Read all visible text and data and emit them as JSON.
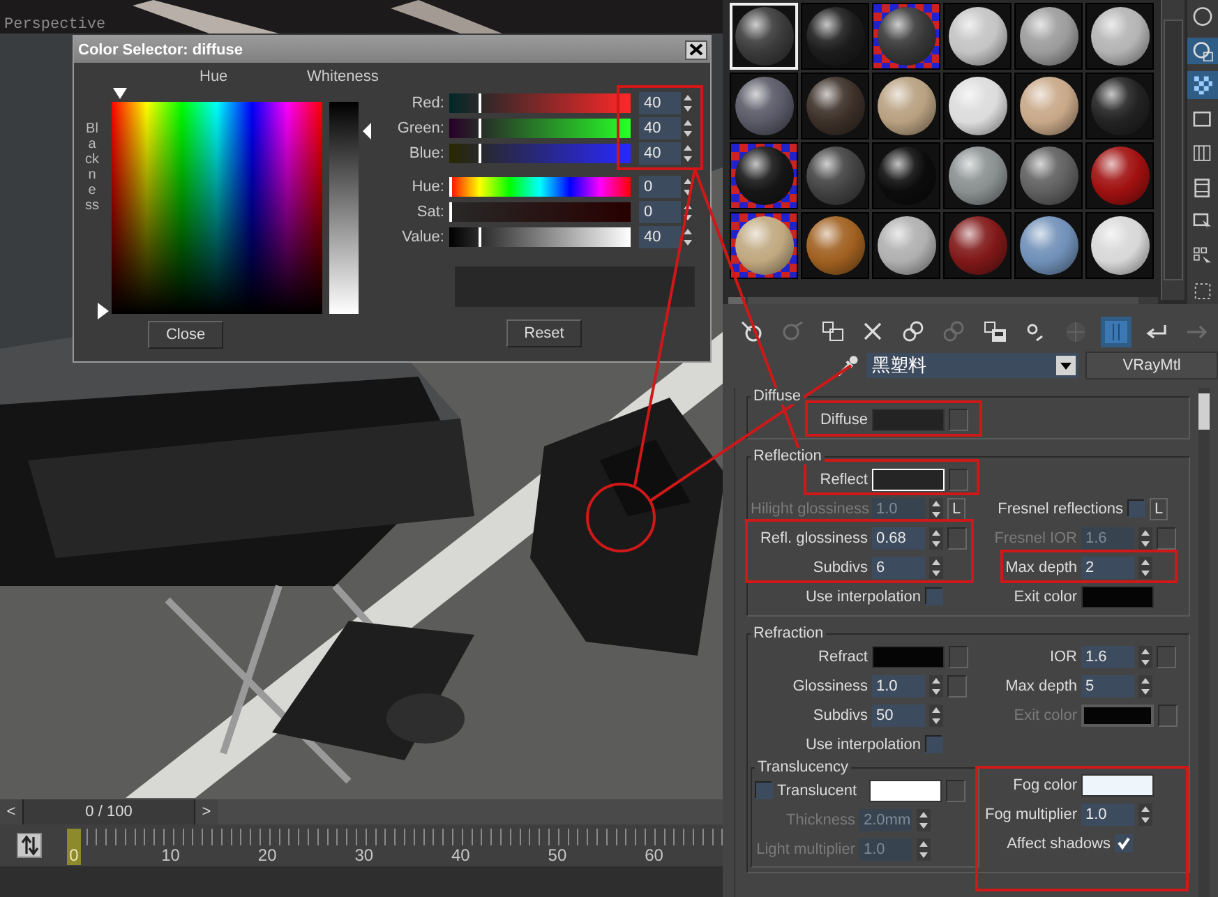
{
  "viewport": {
    "label": "Perspective"
  },
  "color_selector": {
    "title": "Color Selector: diffuse",
    "hue_label": "Hue",
    "whiteness_label": "Whiteness",
    "blackness_label": "Blackness",
    "channels": [
      {
        "kind": "red",
        "label": "Red:",
        "value": "40",
        "level": 0.157
      },
      {
        "kind": "green",
        "label": "Green:",
        "value": "40",
        "level": 0.157
      },
      {
        "kind": "blue",
        "label": "Blue:",
        "value": "40",
        "level": 0.157
      },
      {
        "kind": "hue",
        "label": "Hue:",
        "value": "0",
        "level": 0
      },
      {
        "kind": "sat",
        "label": "Sat:",
        "value": "0",
        "level": 0
      },
      {
        "kind": "value",
        "label": "Value:",
        "value": "40",
        "level": 0.157
      }
    ],
    "close_button": "Close",
    "reset_button": "Reset"
  },
  "timeline": {
    "prev": "<",
    "frame": "0 / 100",
    "next": ">",
    "level": 0,
    "ticks": [
      "0",
      "10",
      "20",
      "30",
      "40",
      "50",
      "60"
    ]
  },
  "material_editor": {
    "slots": [
      {
        "color": "#3a3a3a",
        "checker": false,
        "selected": true
      },
      {
        "color": "#1c1c1c",
        "checker": false,
        "selected": false
      },
      {
        "color": "#383838",
        "checker": true,
        "selected": false
      },
      {
        "color": "#c4c4c4",
        "checker": false,
        "selected": false
      },
      {
        "color": "#9c9c9c",
        "checker": false,
        "selected": false
      },
      {
        "color": "#b4b4b4",
        "checker": false,
        "selected": false
      },
      {
        "color": "#5a5a68",
        "checker": false,
        "selected": false
      },
      {
        "color": "#3c3028",
        "checker": false,
        "selected": false
      },
      {
        "color": "#b8a080",
        "checker": false,
        "selected": false
      },
      {
        "color": "#dcdcdc",
        "checker": false,
        "selected": false
      },
      {
        "color": "#c8a888",
        "checker": false,
        "selected": false
      },
      {
        "color": "#222222",
        "checker": false,
        "selected": false
      },
      {
        "color": "#161616",
        "checker": true,
        "selected": false
      },
      {
        "color": "#424242",
        "checker": false,
        "selected": false
      },
      {
        "color": "#0c0c0c",
        "checker": false,
        "selected": false
      },
      {
        "color": "#8a9090",
        "checker": false,
        "selected": false
      },
      {
        "color": "#606060",
        "checker": false,
        "selected": false
      },
      {
        "color": "#a01010",
        "checker": false,
        "selected": false
      },
      {
        "color": "#c0a880",
        "checker": true,
        "selected": false
      },
      {
        "color": "#a06020",
        "checker": false,
        "selected": false
      },
      {
        "color": "#b0b0b0",
        "checker": false,
        "selected": false
      },
      {
        "color": "#801818",
        "checker": false,
        "selected": false
      },
      {
        "color": "#7090b8",
        "checker": false,
        "selected": false
      },
      {
        "color": "#d8d8d8",
        "checker": false,
        "selected": false
      }
    ],
    "side_tools": [
      {
        "kind": "sphere",
        "on": false
      },
      {
        "kind": "backlight",
        "on": true
      },
      {
        "kind": "checker",
        "on": true
      },
      {
        "kind": "square",
        "on": false
      },
      {
        "kind": "stripes",
        "on": false
      },
      {
        "kind": "film",
        "on": false
      },
      {
        "kind": "options",
        "on": false
      },
      {
        "kind": "select",
        "on": false
      },
      {
        "kind": "navigator",
        "on": false
      }
    ],
    "tools": [
      {
        "kind": "get",
        "disabled": false,
        "on": false
      },
      {
        "kind": "put",
        "disabled": true,
        "on": false
      },
      {
        "kind": "assign",
        "disabled": false,
        "on": false
      },
      {
        "kind": "reset",
        "disabled": false,
        "on": false
      },
      {
        "kind": "copy",
        "disabled": false,
        "on": false
      },
      {
        "kind": "unique",
        "disabled": true,
        "on": false
      },
      {
        "kind": "save",
        "disabled": false,
        "on": false
      },
      {
        "kind": "channel",
        "disabled": false,
        "on": false
      },
      {
        "kind": "background",
        "disabled": true,
        "on": false
      },
      {
        "kind": "show",
        "disabled": false,
        "on": true
      },
      {
        "kind": "parent",
        "disabled": false,
        "on": false
      },
      {
        "kind": "sibling",
        "disabled": true,
        "on": false
      }
    ],
    "material_name": "黑塑料",
    "material_type": "VRayMtl",
    "groups": [
      {
        "title": "Diffuse",
        "rows": [
          {
            "left": [
              {
                "kind": "swatch",
                "label": "Diffuse",
                "color": "#232323",
                "outlined": false,
                "disabled": false,
                "map": true
              }
            ]
          }
        ]
      },
      {
        "title": "Reflection",
        "rows": [
          {
            "left": [
              {
                "kind": "swatch",
                "label": "Reflect",
                "color": "#252525",
                "outlined": true,
                "disabled": false,
                "map": true
              }
            ]
          },
          {
            "left": [
              {
                "kind": "spinner",
                "label": "Hilight glossiness",
                "value": "1.0",
                "disabled": true,
                "map": false,
                "lock": "L"
              }
            ],
            "right": [
              {
                "kind": "checkbox",
                "label": "Fresnel reflections",
                "checked": false,
                "disabled": false,
                "lock": "L"
              }
            ]
          },
          {
            "left": [
              {
                "kind": "spinner",
                "label": "Refl. glossiness",
                "value": "0.68",
                "disabled": false,
                "map": true
              }
            ],
            "right": [
              {
                "kind": "spinner",
                "label": "Fresnel IOR",
                "value": "1.6",
                "disabled": true,
                "map": true
              }
            ]
          },
          {
            "left": [
              {
                "kind": "spinner",
                "label": "Subdivs",
                "value": "6",
                "disabled": false,
                "map": false
              }
            ],
            "right": [
              {
                "kind": "spinner",
                "label": "Max depth",
                "value": "2",
                "disabled": false,
                "map": false
              }
            ]
          },
          {
            "left": [
              {
                "kind": "checkbox",
                "label": "Use interpolation",
                "checked": false,
                "disabled": false
              }
            ],
            "right": [
              {
                "kind": "swatch",
                "label": "Exit color",
                "color": "#050505",
                "outlined": false,
                "disabled": false,
                "map": false
              }
            ]
          }
        ]
      },
      {
        "title": "Refraction",
        "rows": [
          {
            "left": [
              {
                "kind": "swatch",
                "label": "Refract",
                "color": "#050505",
                "outlined": false,
                "disabled": false,
                "map": true
              }
            ],
            "right": [
              {
                "kind": "spinner",
                "label": "IOR",
                "value": "1.6",
                "disabled": false,
                "map": true
              }
            ]
          },
          {
            "left": [
              {
                "kind": "spinner",
                "label": "Glossiness",
                "value": "1.0",
                "disabled": false,
                "map": true
              }
            ],
            "right": [
              {
                "kind": "spinner",
                "label": "Max depth",
                "value": "5",
                "disabled": false,
                "map": false
              }
            ]
          },
          {
            "left": [
              {
                "kind": "spinner",
                "label": "Subdivs",
                "value": "50",
                "disabled": false,
                "map": false
              }
            ],
            "right": [
              {
                "kind": "swatch",
                "label": "Exit color",
                "color": "#050505",
                "outlined": false,
                "disabled": true,
                "map": true
              }
            ]
          },
          {
            "left": [
              {
                "kind": "checkbox",
                "label": "Use interpolation",
                "checked": false,
                "disabled": false
              }
            ]
          }
        ],
        "subgroup": {
          "title": "Translucency",
          "rows": [
            {
              "left": [
                {
                  "kind": "checkbox_leading",
                  "label": "Translucent",
                  "checked": false,
                  "disabled": false
                },
                {
                  "kind": "swatch",
                  "color": "#ffffff",
                  "outlined": false,
                  "disabled": false,
                  "map": true
                }
              ]
            },
            {
              "left": [
                {
                  "kind": "spinner",
                  "label": "Thickness",
                  "value": "2.0mm",
                  "disabled": true,
                  "map": false
                }
              ]
            },
            {
              "left": [
                {
                  "kind": "spinner",
                  "label": "Light multiplier",
                  "value": "1.0",
                  "disabled": true,
                  "map": false
                }
              ]
            }
          ]
        },
        "side_rows": [
          {
            "right": [
              {
                "kind": "swatch",
                "label": "Fog color",
                "color": "#eef6fc",
                "outlined": false,
                "disabled": false,
                "map": false
              }
            ]
          },
          {
            "right": [
              {
                "kind": "spinner",
                "label": "Fog multiplier",
                "value": "1.0",
                "disabled": false,
                "map": false
              }
            ]
          },
          {
            "right": [
              {
                "kind": "checkbox",
                "label": "Affect shadows",
                "checked": true,
                "disabled": false
              }
            ]
          }
        ]
      }
    ]
  }
}
